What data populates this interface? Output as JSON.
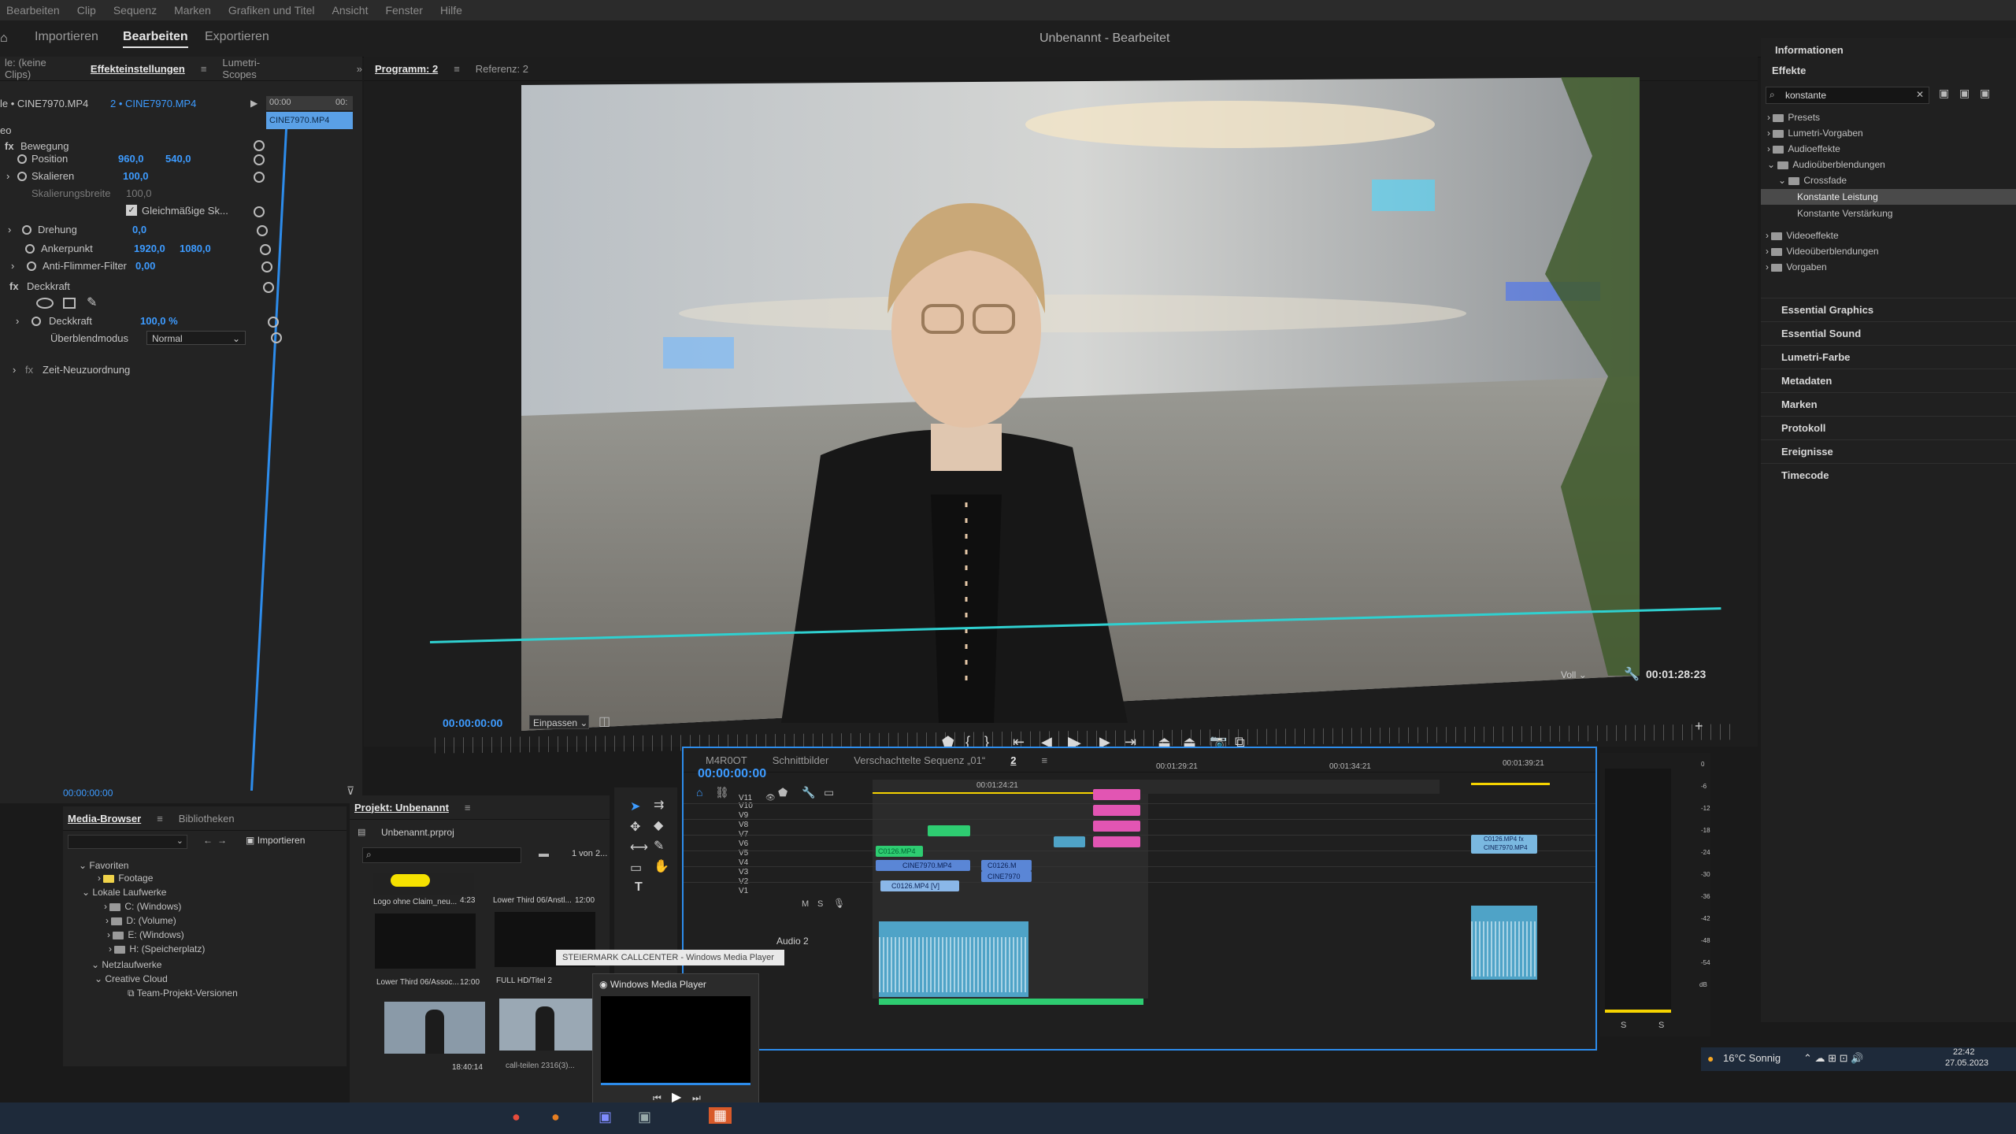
{
  "menu": [
    "Bearbeiten",
    "Clip",
    "Sequenz",
    "Marken",
    "Grafiken und Titel",
    "Ansicht",
    "Fenster",
    "Hilfe"
  ],
  "workspace_tabs": [
    "Importieren",
    "Bearbeiten",
    "Exportieren"
  ],
  "doc_title": "Unbenannt - Bearbeitet",
  "effect_controls": {
    "tabs": [
      "le: (keine Clips)",
      "Effekteinstellungen",
      "Lumetri-Scopes"
    ],
    "clip_header": "le • CINE7970.MP4",
    "clip_master": "2 • CINE7970.MP4",
    "timeline_clip": "CINE7970.MP4",
    "ruler_start": "00:00",
    "ruler_end": "00:",
    "section_label": "eo",
    "movement": "Bewegung",
    "position_label": "Position",
    "position_x": "960,0",
    "position_y": "540,0",
    "scale_label": "Skalieren",
    "scale_value": "100,0",
    "scale_width_label": "Skalierungsbreite",
    "scale_width_value": "100,0",
    "uniform_scale": "Gleichmäßige Sk...",
    "rotation_label": "Drehung",
    "rotation_value": "0,0",
    "anchor_label": "Ankerpunkt",
    "anchor_x": "1920,0",
    "anchor_y": "1080,0",
    "antiflicker_label": "Anti-Flimmer-Filter",
    "antiflicker_value": "0,00",
    "opacity_group": "Deckkraft",
    "opacity_label": "Deckkraft",
    "opacity_value": "100,0 %",
    "blend_label": "Überblendmodus",
    "blend_value": "Normal",
    "time_remap": "Zeit-Neuzuordnung",
    "footer_time": "00:00:00:00"
  },
  "program_monitor": {
    "tabs": [
      "Programm: 2",
      "Referenz: 2"
    ],
    "current_time": "00:00:00:00",
    "fit": "Einpassen",
    "quality": "Voll",
    "duration": "00:01:28:23"
  },
  "right_panel": {
    "info": "Informationen",
    "effects": "Effekte",
    "search_value": "konstante",
    "tree": [
      "Presets",
      "Lumetri-Vorgaben",
      "Audioeffekte",
      "Audioüberblendungen",
      "Crossfade",
      "Konstante Leistung",
      "Konstante Verstärkung",
      "Videoeffekte",
      "Videoüberblendungen",
      "Vorgaben"
    ],
    "sections": [
      "Essential Graphics",
      "Essential Sound",
      "Lumetri-Farbe",
      "Metadaten",
      "Marken",
      "Protokoll",
      "Ereignisse",
      "Timecode"
    ]
  },
  "media_browser": {
    "tabs": [
      "Media-Browser",
      "Bibliotheken"
    ],
    "import": "Importieren",
    "tree": [
      "Favoriten",
      "Footage",
      "Lokale Laufwerke",
      "C: (Windows)",
      "D: (Volume)",
      "E: (Windows)",
      "H: (Speicherplatz)",
      "Netzlaufwerke",
      "Creative Cloud",
      "Team-Projekt-Versionen"
    ]
  },
  "project": {
    "tab": "Projekt: Unbenannt",
    "file": "Unbenannt.prproj",
    "count": "1 von 2...",
    "items": [
      {
        "name": "Logo ohne Claim_neu...",
        "dur": "4:23"
      },
      {
        "name": "Lower Third 06/Anstl...",
        "dur": "12:00"
      },
      {
        "name": "Lower Third 06/Assoc...",
        "dur": "12:00"
      },
      {
        "name": "FULL HD/Titel 2",
        "dur": ""
      },
      {
        "name": "",
        "dur": "18:40:14"
      },
      {
        "name": "call-teilen 2316(3)...",
        "dur": ""
      }
    ]
  },
  "timeline": {
    "tabs": [
      "M4R0OT",
      "Schnittbilder",
      "Verschachtelte Sequenz „01“",
      "2"
    ],
    "current_time": "00:00:00:00",
    "ruler": [
      "00:01:24:21",
      "00:01:29:21",
      "00:01:34:21",
      "00:01:39:21"
    ],
    "tracks_video": [
      "V11",
      "V10",
      "V9",
      "V8",
      "V7",
      "V6",
      "V5",
      "V4",
      "V3",
      "V2",
      "V1"
    ],
    "audio_label": "Audio 2",
    "clip_labels": [
      "C0126.MP4",
      "CINE7970.MP4",
      "C0126.M",
      "CINE7970",
      "C0126.MP4 [V]",
      "C0126.MP4 fx",
      "CINE7970.MP4"
    ]
  },
  "meter": {
    "scale": [
      "0",
      "-6",
      "-12",
      "-18",
      "-24",
      "-30",
      "-36",
      "-42",
      "-48",
      "-54",
      "dB"
    ],
    "solo": [
      "S",
      "S"
    ]
  },
  "wmp": {
    "tooltip": "STEIERMARK CALLCENTER - Windows Media Player",
    "title": "Windows Media Player"
  },
  "taskbar": {
    "weather": "16°C Sonnig",
    "time": "22:42",
    "date": "27.05.2023"
  },
  "colors": {
    "accent": "#2d8ceb",
    "value_blue": "#3d9bff",
    "clip_pink": "#e255b3",
    "clip_green": "#2ecc71",
    "clip_audio": "#4fa3c7"
  }
}
